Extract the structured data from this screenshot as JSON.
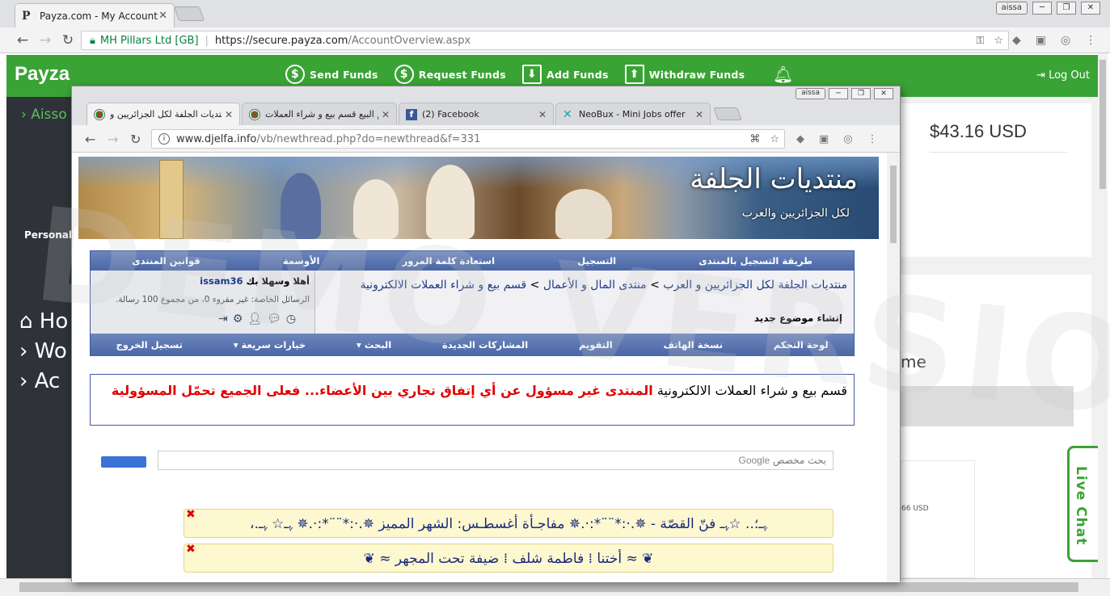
{
  "outer_browser": {
    "tab_title": "Payza.com - My Account",
    "tab_favicon": "P",
    "close_glyph": "✕",
    "user_badge": "aissa",
    "secure_org": "MH Pillars Ltd [GB]",
    "url_host": "https://secure.payza.com",
    "url_path": "/AccountOverview.aspx"
  },
  "payza": {
    "logo": "Payza",
    "menu": [
      {
        "icon": "$",
        "label": "Send Funds"
      },
      {
        "icon": "$",
        "label": "Request Funds"
      },
      {
        "icon": "⬇",
        "label": "Add Funds"
      },
      {
        "icon": "⬆",
        "label": "Withdraw Funds"
      }
    ],
    "logout": "Log Out",
    "side_user": "› Aisso",
    "side_personal": "Personal",
    "side_nav": [
      "Ho",
      "Wo",
      "Ac"
    ],
    "balance": "$43.16 USD",
    "welcome_fragment": "me",
    "chart_fragment_label": "66 USD",
    "live_chat": "Live Chat",
    "watermark": "DEMO VERSION",
    "brand_color": "#3aa335"
  },
  "inner_browser": {
    "user_badge": "aissa",
    "tabs": [
      {
        "title": "منتديات الجلفة لكل الجزائريين و",
        "active": true
      },
      {
        "title": "تم البيع قسم بيع و شراء العملات",
        "active": false
      },
      {
        "title": "(2) Facebook",
        "active": false
      },
      {
        "title": "NeoBux - Mini Jobs offer",
        "active": false
      }
    ],
    "close_glyph": "✕",
    "url_host": "www.djelfa.info",
    "url_path": "/vb/newthread.php?do=newthread&f=331"
  },
  "forum": {
    "logo": "منتديات الجلفة",
    "logo_sub": "لكل الجزائريين والعرب",
    "top_links": [
      "طريقة التسجيل بالمنتدى",
      "التسجيل",
      "استعادة كلمة المرور",
      "الأوسمة",
      "قوانين المنتدى"
    ],
    "greeting": "أهلا وسهلا بك",
    "username": "issam36",
    "pm_label": "الرسائل الخاصة",
    "pm_text": ": غير مقروء 0، من مجموع 100 رسالة.",
    "breadcrumb_1": "منتديات الجلفة لكل الجزائريين و العرب",
    "breadcrumb_2": "منتدى المال و الأعمال",
    "breadcrumb_3": "قسم بيع و شراء العملات الالكترونية",
    "crumb_sep": " > ",
    "new_thread": "إنشاء موضوع جديد",
    "bottom_links": [
      "لوحة التحكم",
      "نسخة الهاتف",
      "التقويم",
      "المشاركات الجديدة",
      "البحث ▾",
      "خيارات سريعة ▾",
      "تسجيل الخروج"
    ],
    "notice_black": "قسم بيع و شراء العملات الالكترونية ",
    "notice_red": "المنتدى غير مسؤول عن أي إتفاق تجاري بين الأعضاء... فعلى الجميع تحمّل المسؤولية",
    "search_brand": "Google",
    "search_placeholder": "بحث مخصص",
    "tickers": [
      "ﮩـ؛.. ☆ﮩـ فنّ القصّة - ✵.·:*¨¨*:·.✵ مفاجـأة أغسطـس: الشهر المميز ✵.·:*¨¨*:·.✵ ﮩـ☆ ﮩـ.،",
      "❦ ≈ أختنا ⁞ فاطمة شلف ⁞ ضيفة تحت المجهر ≈ ❦"
    ],
    "ticker_close": "✖"
  }
}
